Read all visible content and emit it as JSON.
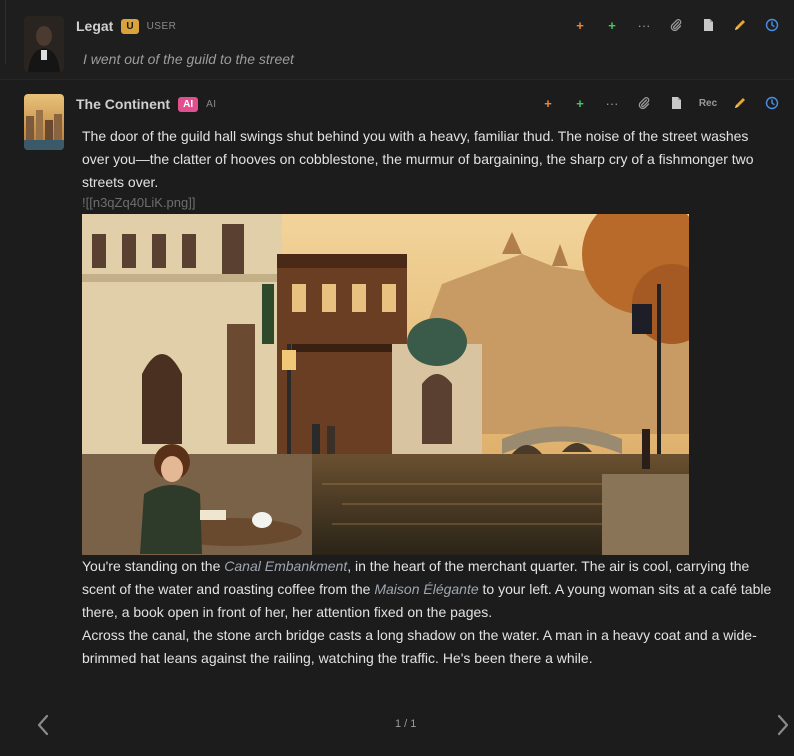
{
  "user_message": {
    "name": "Legat",
    "badge": "U",
    "role": "USER",
    "text": "I went out of the guild to the street",
    "actions": [
      "plus-orange-icon",
      "plus-green-icon",
      "more-icon",
      "attach-icon",
      "document-icon",
      "edit-icon",
      "history-icon"
    ]
  },
  "ai_message": {
    "name": "The Continent",
    "badge": "AI",
    "role": "AI",
    "rec_label": "Rec",
    "paragraph1": "The door of the guild hall swings shut behind you with a heavy, familiar thud. The noise of the street washes over you—the clatter of hooves on cobblestone, the murmur of bargaining, the sharp cry of a fishmonger two streets over.",
    "image_ref": "![[n3qZq40LiK.png]]",
    "p2_a": "You're standing on the ",
    "p2_place1": "Canal Embankment",
    "p2_b": ", in the heart of the merchant quarter. The air is cool, carrying the scent of the water and roasting coffee from the ",
    "p2_place2": "Maison Élégante",
    "p2_c": " to your left. A young woman sits at a café table there, a book open in front of her, her attention fixed on the pages.",
    "paragraph3": "Across the canal, the stone arch bridge casts a long shadow on the water. A man in a heavy coat and a wide-brimmed hat leans against the railing, watching the traffic. He's been there a while."
  },
  "pager": {
    "text": "1 / 1"
  },
  "colors": {
    "background": "#1a1a1a",
    "user_badge": "#d9a23a",
    "ai_badge": "#e0508f",
    "plus_orange": "#e8893a",
    "plus_green": "#4cc36a",
    "clock_blue": "#4a8ee8",
    "pencil_yellow": "#e8a830"
  }
}
